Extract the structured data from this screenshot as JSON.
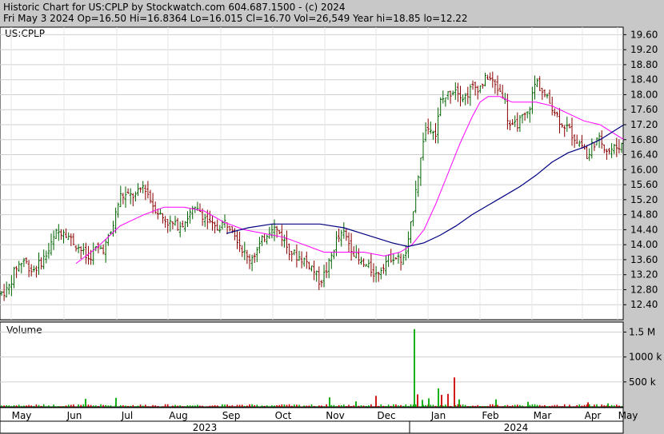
{
  "header": {
    "line1": "Historic Chart for US:CPLP by Stockwatch.com 604.687.1500 - (c) 2024",
    "line2": "Fri May  3 2024   Op=16.50   Hi=16.8364   Lo=16.015   Cl=16.70   Vol=26,549   Year hi=18.85   lo=12.22"
  },
  "chart_data": {
    "type": "ohlc",
    "symbol_label": "US:CPLP",
    "volume_label": "Volume",
    "price_ticks": [
      "19.60",
      "19.20",
      "18.80",
      "18.40",
      "18.00",
      "17.60",
      "17.20",
      "16.80",
      "16.40",
      "16.00",
      "15.60",
      "15.20",
      "14.80",
      "14.40",
      "14.00",
      "13.60",
      "13.20",
      "12.80",
      "12.40"
    ],
    "volume_ticks": [
      "1.5 M",
      "1000 k",
      "500 k"
    ],
    "month_labels": [
      "May",
      "Jun",
      "Jul",
      "Aug",
      "Sep",
      "Oct",
      "Nov",
      "Dec",
      "Jan",
      "Feb",
      "Mar",
      "Apr",
      "May"
    ],
    "year_labels": [
      "2023",
      "2024"
    ],
    "price_ylim": [
      12.0,
      19.8
    ],
    "volume_ylim": [
      0,
      1700000
    ],
    "colors": {
      "up": "#006400",
      "down": "#8b0000",
      "ma_short": "#ff00ff",
      "ma_long": "#000080",
      "vol_up": "#00aa00",
      "vol_down": "#cc0000"
    },
    "price_path": [
      [
        0,
        12.7
      ],
      [
        10,
        12.8
      ],
      [
        20,
        13.4
      ],
      [
        30,
        13.6
      ],
      [
        40,
        13.3
      ],
      [
        50,
        13.5
      ],
      [
        60,
        13.8
      ],
      [
        70,
        14.3
      ],
      [
        80,
        14.4
      ],
      [
        90,
        14.1
      ],
      [
        100,
        13.9
      ],
      [
        110,
        13.6
      ],
      [
        120,
        13.9
      ],
      [
        130,
        13.9
      ],
      [
        140,
        14.4
      ],
      [
        150,
        15.3
      ],
      [
        160,
        15.3
      ],
      [
        170,
        15.3
      ],
      [
        180,
        15.6
      ],
      [
        190,
        15.1
      ],
      [
        200,
        14.8
      ],
      [
        210,
        14.6
      ],
      [
        220,
        14.5
      ],
      [
        230,
        14.6
      ],
      [
        240,
        14.9
      ],
      [
        250,
        14.9
      ],
      [
        260,
        14.6
      ],
      [
        270,
        14.4
      ],
      [
        280,
        14.6
      ],
      [
        290,
        14.5
      ],
      [
        300,
        14.0
      ],
      [
        310,
        13.6
      ],
      [
        320,
        13.8
      ],
      [
        330,
        14.2
      ],
      [
        340,
        14.5
      ],
      [
        350,
        14.3
      ],
      [
        360,
        13.9
      ],
      [
        370,
        13.7
      ],
      [
        380,
        13.6
      ],
      [
        390,
        13.4
      ],
      [
        400,
        13.0
      ],
      [
        410,
        13.4
      ],
      [
        420,
        14.1
      ],
      [
        430,
        14.3
      ],
      [
        440,
        13.9
      ],
      [
        450,
        13.5
      ],
      [
        460,
        13.4
      ],
      [
        470,
        13.2
      ],
      [
        480,
        13.5
      ],
      [
        490,
        13.7
      ],
      [
        500,
        13.6
      ],
      [
        505,
        13.6
      ],
      [
        510,
        14.0
      ],
      [
        515,
        14.7
      ],
      [
        520,
        15.6
      ],
      [
        525,
        16.1
      ],
      [
        530,
        17.0
      ],
      [
        540,
        17.2
      ],
      [
        545,
        16.9
      ],
      [
        550,
        17.8
      ],
      [
        560,
        18.0
      ],
      [
        570,
        18.2
      ],
      [
        580,
        17.9
      ],
      [
        590,
        18.2
      ],
      [
        600,
        18.2
      ],
      [
        610,
        18.5
      ],
      [
        620,
        18.2
      ],
      [
        630,
        18.0
      ],
      [
        635,
        17.3
      ],
      [
        640,
        17.1
      ],
      [
        650,
        17.3
      ],
      [
        660,
        17.5
      ],
      [
        670,
        18.4
      ],
      [
        680,
        18.0
      ],
      [
        690,
        17.7
      ],
      [
        700,
        17.3
      ],
      [
        710,
        17.1
      ],
      [
        720,
        16.8
      ],
      [
        730,
        16.6
      ],
      [
        735,
        16.2
      ],
      [
        740,
        16.7
      ],
      [
        750,
        16.8
      ],
      [
        760,
        16.5
      ],
      [
        770,
        16.6
      ],
      [
        780,
        16.7
      ]
    ],
    "ma_short": [
      [
        95,
        13.5
      ],
      [
        120,
        13.9
      ],
      [
        150,
        14.5
      ],
      [
        180,
        14.8
      ],
      [
        205,
        15.0
      ],
      [
        230,
        15.0
      ],
      [
        255,
        14.9
      ],
      [
        280,
        14.6
      ],
      [
        305,
        14.4
      ],
      [
        330,
        14.3
      ],
      [
        355,
        14.2
      ],
      [
        380,
        14.0
      ],
      [
        405,
        13.8
      ],
      [
        430,
        13.8
      ],
      [
        455,
        13.8
      ],
      [
        480,
        13.7
      ],
      [
        500,
        13.8
      ],
      [
        515,
        14.0
      ],
      [
        530,
        14.4
      ],
      [
        545,
        15.1
      ],
      [
        560,
        15.9
      ],
      [
        575,
        16.7
      ],
      [
        590,
        17.4
      ],
      [
        600,
        17.8
      ],
      [
        610,
        17.95
      ],
      [
        625,
        17.95
      ],
      [
        640,
        17.8
      ],
      [
        655,
        17.8
      ],
      [
        670,
        17.8
      ],
      [
        690,
        17.7
      ],
      [
        710,
        17.5
      ],
      [
        730,
        17.3
      ],
      [
        750,
        17.2
      ],
      [
        765,
        17.0
      ],
      [
        780,
        16.8
      ]
    ],
    "ma_long": [
      [
        283,
        14.3
      ],
      [
        310,
        14.45
      ],
      [
        340,
        14.55
      ],
      [
        370,
        14.55
      ],
      [
        400,
        14.55
      ],
      [
        430,
        14.45
      ],
      [
        460,
        14.25
      ],
      [
        490,
        14.05
      ],
      [
        510,
        13.95
      ],
      [
        530,
        14.05
      ],
      [
        550,
        14.25
      ],
      [
        570,
        14.5
      ],
      [
        590,
        14.8
      ],
      [
        610,
        15.05
      ],
      [
        630,
        15.3
      ],
      [
        650,
        15.55
      ],
      [
        670,
        15.85
      ],
      [
        690,
        16.2
      ],
      [
        710,
        16.45
      ],
      [
        730,
        16.6
      ],
      [
        750,
        16.8
      ],
      [
        765,
        17.0
      ],
      [
        780,
        17.2
      ]
    ],
    "volume_spikes": [
      [
        518,
        1560000
      ],
      [
        522,
        250000
      ],
      [
        528,
        140000
      ],
      [
        536,
        170000
      ],
      [
        548,
        370000
      ],
      [
        552,
        240000
      ],
      [
        560,
        260000
      ],
      [
        568,
        590000
      ],
      [
        574,
        150000
      ],
      [
        107,
        160000
      ],
      [
        145,
        180000
      ],
      [
        412,
        190000
      ],
      [
        470,
        220000
      ],
      [
        445,
        110000
      ],
      [
        620,
        150000
      ],
      [
        660,
        100000
      ],
      [
        735,
        90000
      ],
      [
        760,
        70000
      ]
    ]
  }
}
